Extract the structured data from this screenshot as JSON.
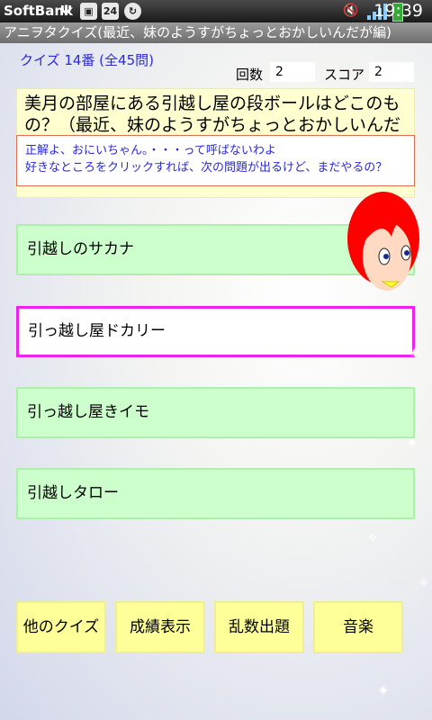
{
  "status_bar": {
    "carrier": "SoftBank",
    "clock": "19:39",
    "badge": "24"
  },
  "title": "アニヲタクイズ(最近、妹のようすがちょっとおかしいんだが編)",
  "quiz_number": "クイズ 14番 (全45問)",
  "stats": {
    "count_label": "回数",
    "count_value": "2",
    "score_label": "スコア",
    "score_value": "2"
  },
  "question": "美月の部屋にある引越し屋の段ボールはどこのもの？（最近、妹のようすがちょっとおかしいんだが編）",
  "response": {
    "line1": "正解よ、おにいちゃん。・・・って呼ばないわよ",
    "line2": "好きなところをクリックすれば、次の問題が出るけど、まだやるの？"
  },
  "choices": [
    "引越しのサカナ",
    "引っ越し屋ドカリー",
    "引っ越し屋きイモ",
    "引越しタロー"
  ],
  "selected_choice": 1,
  "buttons": {
    "other_quiz": "他のクイズ",
    "show_results": "成績表示",
    "random": "乱数出題",
    "music": "音楽"
  },
  "colors": {
    "choice_bg": "#ccffcc",
    "selected_border": "#ee22ee",
    "button_bg": "#ffff99",
    "question_bg": "#ffffd0",
    "accent_text": "#2a2ad8"
  }
}
